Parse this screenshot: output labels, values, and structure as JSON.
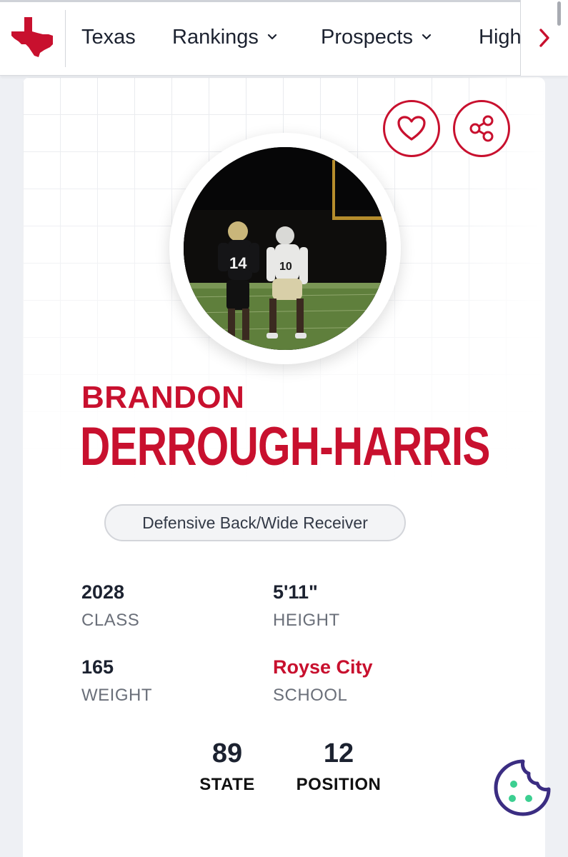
{
  "nav": {
    "items": [
      {
        "label": "Texas",
        "dropdown": false
      },
      {
        "label": "Rankings",
        "dropdown": true
      },
      {
        "label": "Prospects",
        "dropdown": true
      },
      {
        "label": "High",
        "dropdown": false
      }
    ],
    "next_icon": "chevron-right-icon"
  },
  "colors": {
    "brand_red": "#c8102e",
    "cookie_purple": "#3b2d82",
    "cookie_green": "#3ccf91"
  },
  "profile": {
    "first_name": "BRANDON",
    "last_name": "DERROUGH-HARRIS",
    "position": "Defensive Back/Wide Receiver",
    "stats": [
      {
        "value": "2028",
        "label": "CLASS"
      },
      {
        "value": "5'11\"",
        "label": "HEIGHT"
      },
      {
        "value": "165",
        "label": "WEIGHT"
      },
      {
        "value": "Royse City",
        "label": "SCHOOL"
      }
    ],
    "rankings": [
      {
        "value": "89",
        "label": "STATE"
      },
      {
        "value": "12",
        "label": "POSITION"
      }
    ],
    "photo_jersey_numbers": [
      "14",
      "10"
    ]
  },
  "icons": {
    "favorite": "heart-icon",
    "share": "share-icon",
    "cookie": "cookie-icon",
    "logo": "texas-state-logo"
  }
}
